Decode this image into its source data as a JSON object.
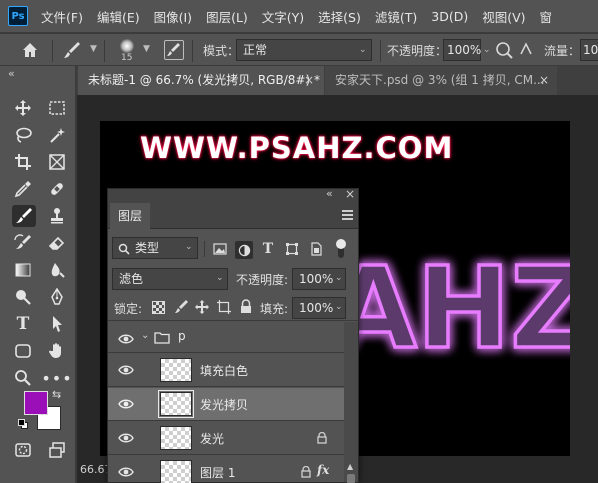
{
  "app": {
    "logo": "Ps"
  },
  "menu": [
    "文件(F)",
    "编辑(E)",
    "图像(I)",
    "图层(L)",
    "文字(Y)",
    "选择(S)",
    "滤镜(T)",
    "3D(D)",
    "视图(V)",
    "窗"
  ],
  "options": {
    "brush_size": "15",
    "mode_label": "模式：",
    "mode_value": "正常",
    "opacity_label": "不透明度：",
    "opacity_value": "100%",
    "flow_label": "流量：",
    "flow_value": "10"
  },
  "tabs": [
    {
      "label": "未标题-1 @ 66.7% (发光拷贝, RGB/8#) *",
      "close": "×"
    },
    {
      "label": "安家天下.psd @ 3% (组 1 拷贝, CM...",
      "close": "×"
    }
  ],
  "canvas": {
    "watermark": "WWW.PSAHZ.COM",
    "glow_text": "AHZ",
    "zoom_status": "66.67"
  },
  "colors": {
    "foreground": "#9a0fb8",
    "background": "#ffffff",
    "glow": "#d13cff"
  },
  "layers_panel": {
    "title": "图层",
    "filter_label": "类型",
    "blend_mode": "滤色",
    "opacity_label": "不透明度:",
    "opacity_value": "100%",
    "lock_label": "锁定:",
    "fill_label": "填充:",
    "fill_value": "100%",
    "layers": [
      {
        "name": "p",
        "type": "group"
      },
      {
        "name": "填充白色",
        "type": "pixel"
      },
      {
        "name": "发光拷贝",
        "type": "pixel",
        "selected": true
      },
      {
        "name": "发光",
        "type": "pixel",
        "locked": true
      },
      {
        "name": "图层 1",
        "type": "pixel",
        "locked": true,
        "fx": "fx"
      }
    ]
  }
}
